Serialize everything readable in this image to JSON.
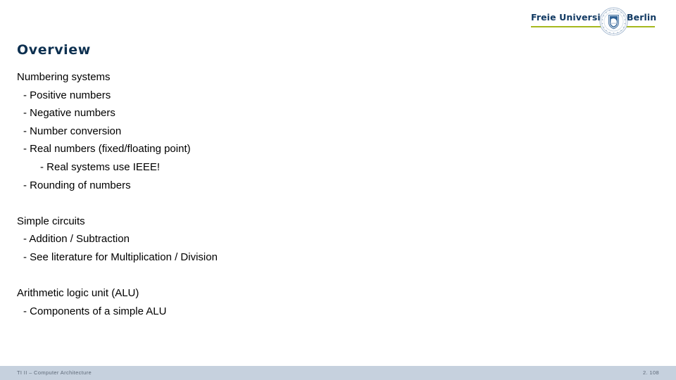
{
  "colors": {
    "title": "#0d3050",
    "logo_text": "#123a63",
    "logo_rule": "#a6b81d",
    "footer_bar": "#c6d1de",
    "footer_text": "#5f6a78",
    "body_text": "#000000",
    "background": "#ffffff"
  },
  "logo": {
    "word_left": "Freie Universität",
    "word_right": "Berlin",
    "seal_icon": "university-seal-icon",
    "rule_icon": "olive-rule-divider"
  },
  "slide": {
    "title": "Overview",
    "blocks": [
      {
        "lines": [
          {
            "level": 0,
            "text": "Numbering systems"
          },
          {
            "level": 1,
            "text": "- Positive numbers"
          },
          {
            "level": 1,
            "text": "- Negative numbers"
          },
          {
            "level": 1,
            "text": "- Number conversion"
          },
          {
            "level": 1,
            "text": "- Real numbers (fixed/floating point)"
          },
          {
            "level": 2,
            "text": "- Real systems use IEEE!"
          },
          {
            "level": 1,
            "text": "- Rounding of numbers"
          }
        ]
      },
      {
        "lines": [
          {
            "level": 0,
            "text": "Simple circuits"
          },
          {
            "level": 1,
            "text": "- Addition / Subtraction"
          },
          {
            "level": 1,
            "text": "- See literature for Multiplication / Division"
          }
        ]
      },
      {
        "lines": [
          {
            "level": 0,
            "text": "Arithmetic logic unit (ALU)"
          },
          {
            "level": 1,
            "text": "- Components of a simple ALU"
          }
        ]
      }
    ]
  },
  "footer": {
    "course": "TI II – Computer Architecture",
    "page": "2. 108"
  }
}
